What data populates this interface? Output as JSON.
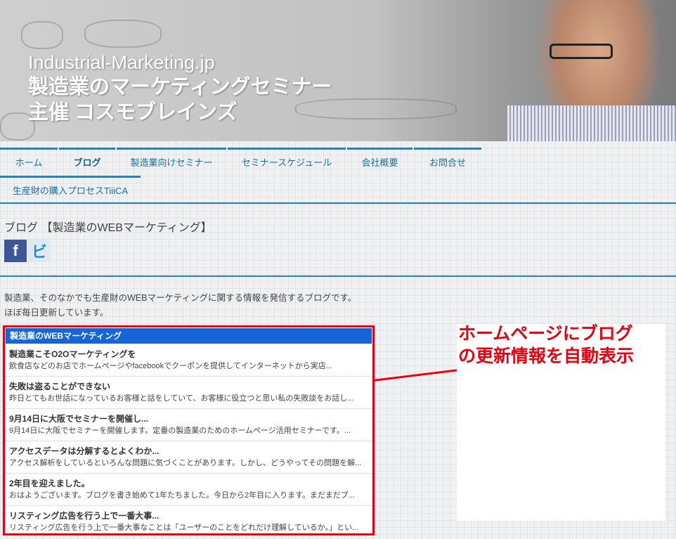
{
  "header": {
    "site_name": "Industrial-Marketing.jp",
    "tagline": "製造業のマーケティングセミナー",
    "organizer": "主催 コスモブレインズ"
  },
  "nav": {
    "items": [
      {
        "label": "ホーム"
      },
      {
        "label": "ブログ"
      },
      {
        "label": "製造業向けセミナー"
      },
      {
        "label": "セミナースケジュール"
      },
      {
        "label": "会社概要"
      },
      {
        "label": "お問合せ"
      },
      {
        "label": "生産財の購入プロセスTiiiCA"
      }
    ]
  },
  "page": {
    "title": "ブログ 【製造業のWEBマーケティング】",
    "intro_line1": "製造業、そのなかでも生産財のWEBマーケティングに関する情報を発信するブログです。",
    "intro_line2": "ほぼ毎日更新しています。"
  },
  "social": {
    "facebook": "f",
    "twitter": "ビ"
  },
  "feed": {
    "title": "製造業のWEBマーケティング",
    "items": [
      {
        "title": "製造業こそO2Oマーケティングを",
        "desc": "飲食店などのお店でホームページやfacebookでクーポンを提供してインターネットから実店..."
      },
      {
        "title": "失敗は盗ることができない",
        "desc": "昨日とてもお世話になっているお客様と話をしていて、お客様に役立つと思い私の失敗談をお話し..."
      },
      {
        "title": "9月14日に大阪でセミナーを開催し...",
        "desc": "9月14日に大阪でセミナーを開催します。定番の製造業のためのホームページ活用セミナーです。..."
      },
      {
        "title": "アクセスデータは分解するとよくわか...",
        "desc": "アクセス解析をしているといろんな問題に気づくことがあります。しかし、どうやってその問題を解..."
      },
      {
        "title": "2年目を迎えました。",
        "desc": "おはようございます。ブログを書き始めて1年たちました。今日から2年目に入ります。まだまだブ..."
      },
      {
        "title": "リスティング広告を行う上で一番大事...",
        "desc": "リスティング広告を行う上で一番大事なことは「ユーザーのことをどれだけ理解しているか。」とい..."
      }
    ]
  },
  "callout": {
    "line1": "ホームページにブログ",
    "line2": "の更新情報を自動表示"
  },
  "colors": {
    "accent": "#2c7fb0",
    "feed_header": "#1565d8",
    "highlight": "#e60012"
  }
}
